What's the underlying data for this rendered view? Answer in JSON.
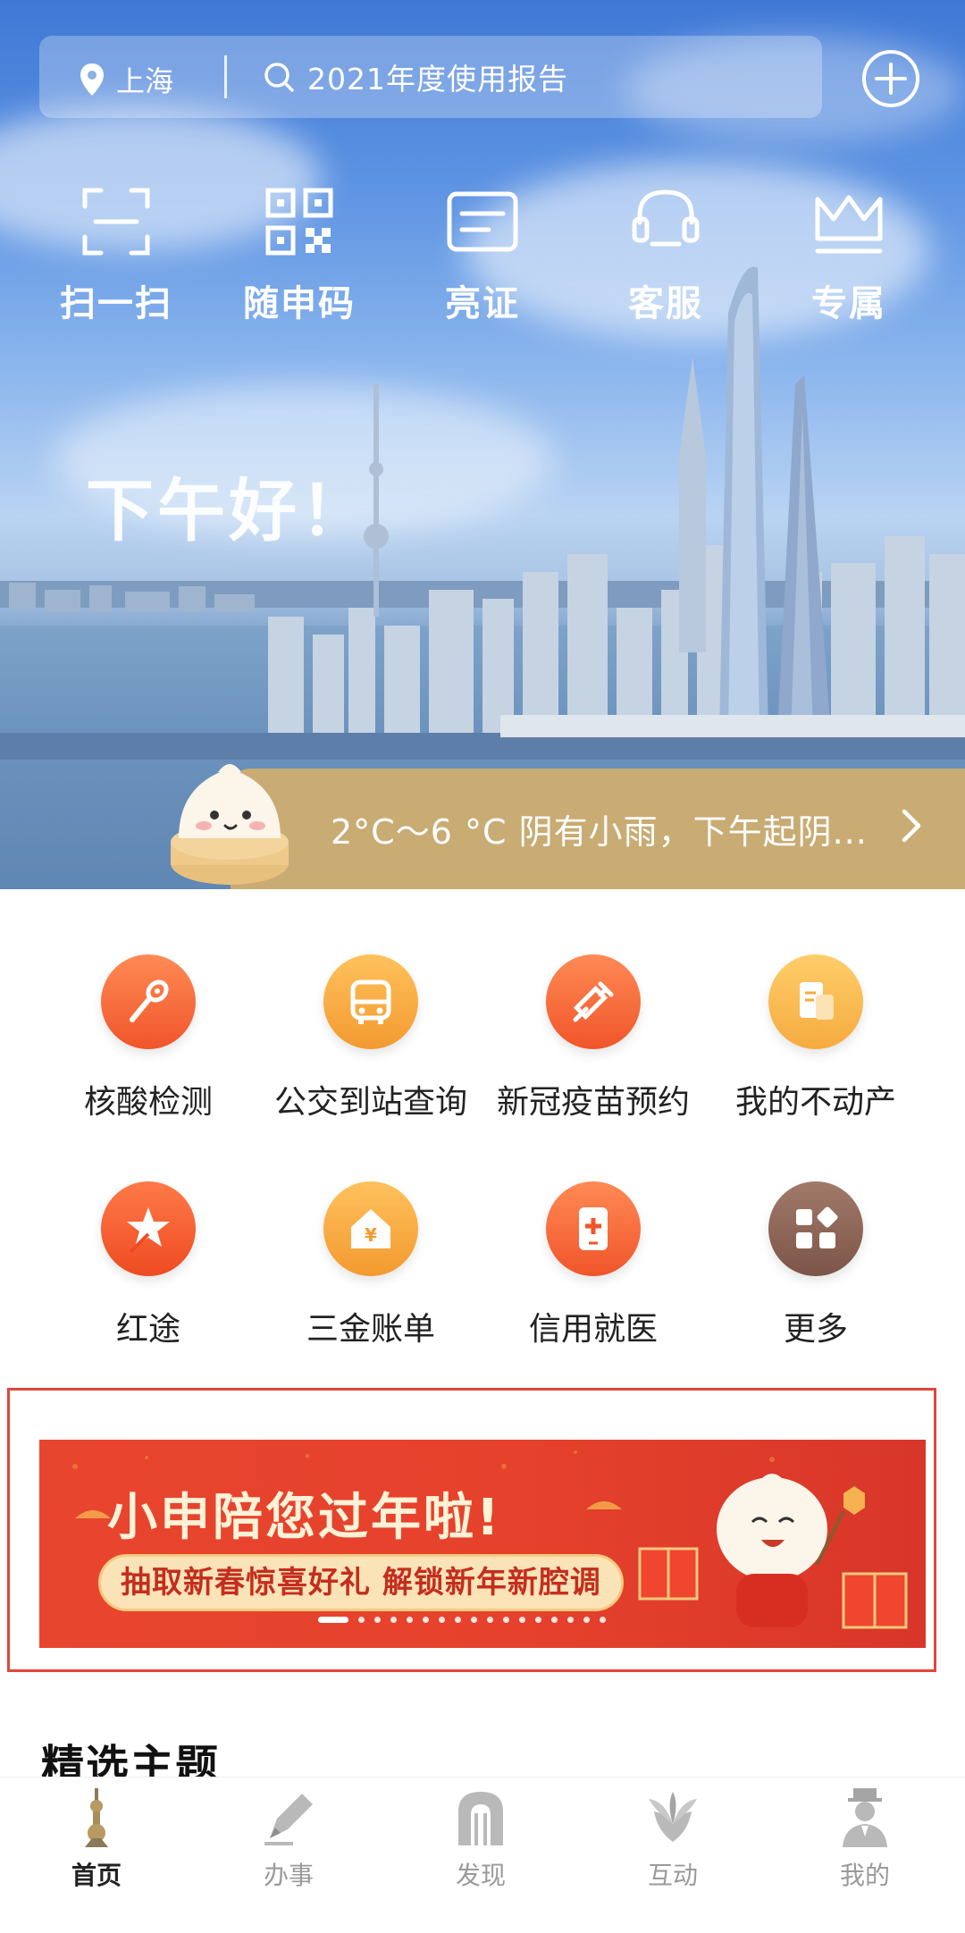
{
  "header": {
    "location": "上海",
    "search_text": "2021年度使用报告"
  },
  "quick_actions": [
    {
      "label": "扫一扫",
      "icon": "scan-icon"
    },
    {
      "label": "随申码",
      "icon": "qr-code-icon"
    },
    {
      "label": "亮证",
      "icon": "id-card-icon"
    },
    {
      "label": "客服",
      "icon": "headset-icon"
    },
    {
      "label": "专属",
      "icon": "crown-icon"
    }
  ],
  "greeting": "下午好！",
  "weather": {
    "text": "2°C～6 °C 阴有小雨，下午起阴..."
  },
  "services": [
    {
      "label": "核酸检测",
      "icon": "swab-test-icon",
      "color": "#f26a34"
    },
    {
      "label": "公交到站查询",
      "icon": "bus-icon",
      "color": "#f5a43c"
    },
    {
      "label": "新冠疫苗预约",
      "icon": "syringe-icon",
      "color": "#f26a34"
    },
    {
      "label": "我的不动产",
      "icon": "property-doc-icon",
      "color": "#f5b04a"
    },
    {
      "label": "红途",
      "icon": "red-star-icon",
      "color": "#f0532a"
    },
    {
      "label": "三金账单",
      "icon": "fund-house-icon",
      "color": "#f5a43c"
    },
    {
      "label": "信用就医",
      "icon": "medical-phone-icon",
      "color": "#f26a34"
    },
    {
      "label": "更多",
      "icon": "more-apps-icon",
      "color": "#8f6a5c"
    }
  ],
  "banner": {
    "title": "小申陪您过年啦!",
    "subtitle": "抽取新春惊喜好礼 解锁新年新腔调",
    "slide_count": 17,
    "active_slide": 1
  },
  "section": {
    "title": "精选主题"
  },
  "tabs": [
    {
      "label": "首页",
      "icon": "home-tower-icon",
      "active": true
    },
    {
      "label": "办事",
      "icon": "pen-icon",
      "active": false
    },
    {
      "label": "发现",
      "icon": "arch-icon",
      "active": false
    },
    {
      "label": "互动",
      "icon": "flower-icon",
      "active": false
    },
    {
      "label": "我的",
      "icon": "profile-icon",
      "active": false
    }
  ],
  "colors": {
    "accent_orange": "#f26a34",
    "weather_band": "#c9ab74",
    "banner_red": "#e5412c",
    "highlight_frame": "#e2473a"
  }
}
